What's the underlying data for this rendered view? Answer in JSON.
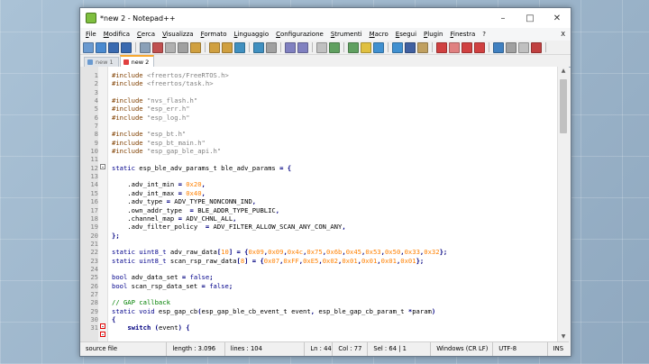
{
  "window": {
    "title": "*new 2 - Notepad++"
  },
  "menu": [
    "File",
    "Modifica",
    "Cerca",
    "Visualizza",
    "Formato",
    "Linguaggio",
    "Configurazione",
    "Strumenti",
    "Macro",
    "Esegui",
    "Plugin",
    "Finestra",
    "?"
  ],
  "menu_right": "X",
  "toolbar_colors": [
    "#6a9ad0",
    "#4a8ad0",
    "#3a6ab0",
    "#3a6ab0",
    "#8aa0b8",
    "#c05050",
    "#b0b0b0",
    "#a0a0a0",
    "#d0a040",
    "#d0a040",
    "#d0a040",
    "#4090c0",
    "#4090c0",
    "#a0a0a0",
    "#8080c0",
    "#8080c0",
    "#c0c0c0",
    "#60a060",
    "#60a060",
    "#e0c040",
    "#4090d0",
    "#4090d0",
    "#4060a0",
    "#c0a060",
    "#d04040",
    "#e08080",
    "#d04040",
    "#d04040",
    "#4080c0",
    "#a0a0a0",
    "#c0c0c0",
    "#c04040"
  ],
  "tabs": [
    {
      "label": "new 1",
      "active": false
    },
    {
      "label": "new 2",
      "active": true
    }
  ],
  "code": {
    "line_numbers": [
      "1",
      "2",
      "3",
      "4",
      "5",
      "6",
      "7",
      "8",
      "9",
      "10",
      "11",
      "12",
      "13",
      "14",
      "15",
      "16",
      "17",
      "18",
      "19",
      "20",
      "21",
      "22",
      "23",
      "24",
      "25",
      "26",
      "27",
      "28",
      "29",
      "30",
      "31"
    ],
    "lines": [
      "#include <freertos/FreeRTOS.h>",
      "#include <freertos/task.h>",
      "",
      "#include \"nvs_flash.h\"",
      "#include \"esp_err.h\"",
      "#include \"esp_log.h\"",
      "",
      "#include \"esp_bt.h\"",
      "#include \"esp_bt_main.h\"",
      "#include \"esp_gap_ble_api.h\"",
      "",
      "static esp_ble_adv_params_t ble_adv_params = {",
      "",
      "    .adv_int_min = 0x20,",
      "    .adv_int_max = 0x40,",
      "    .adv_type = ADV_TYPE_NONCONN_IND,",
      "    .own_addr_type  = BLE_ADDR_TYPE_PUBLIC,",
      "    .channel_map = ADV_CHNL_ALL,",
      "    .adv_filter_policy  = ADV_FILTER_ALLOW_SCAN_ANY_CON_ANY,",
      "};",
      "",
      "static uint8_t adv_raw_data[10] = {0x09,0x09,0x4c,0x75,0x6b,0x45,0x53,0x50,0x33,0x32};",
      "static uint8_t scan_rsp_raw_data[8] = {0x07,0xFF,0xE5,0x02,0x01,0x01,0x01,0x01};",
      "",
      "bool adv_data_set = false;",
      "bool scan_rsp_data_set = false;",
      "",
      "// GAP callback",
      "static void esp_gap_cb(esp_gap_ble_cb_event_t event, esp_ble_gap_cb_param_t *param)",
      "{",
      "    switch (event) {"
    ]
  },
  "status": {
    "file_type": "source file",
    "length": "length : 3.096",
    "lines": "lines : 104",
    "ln": "Ln : 44",
    "col": "Col : 77",
    "sel": "Sel : 64 | 1",
    "eol": "Windows (CR LF)",
    "encoding": "UTF-8",
    "ins": "INS"
  }
}
